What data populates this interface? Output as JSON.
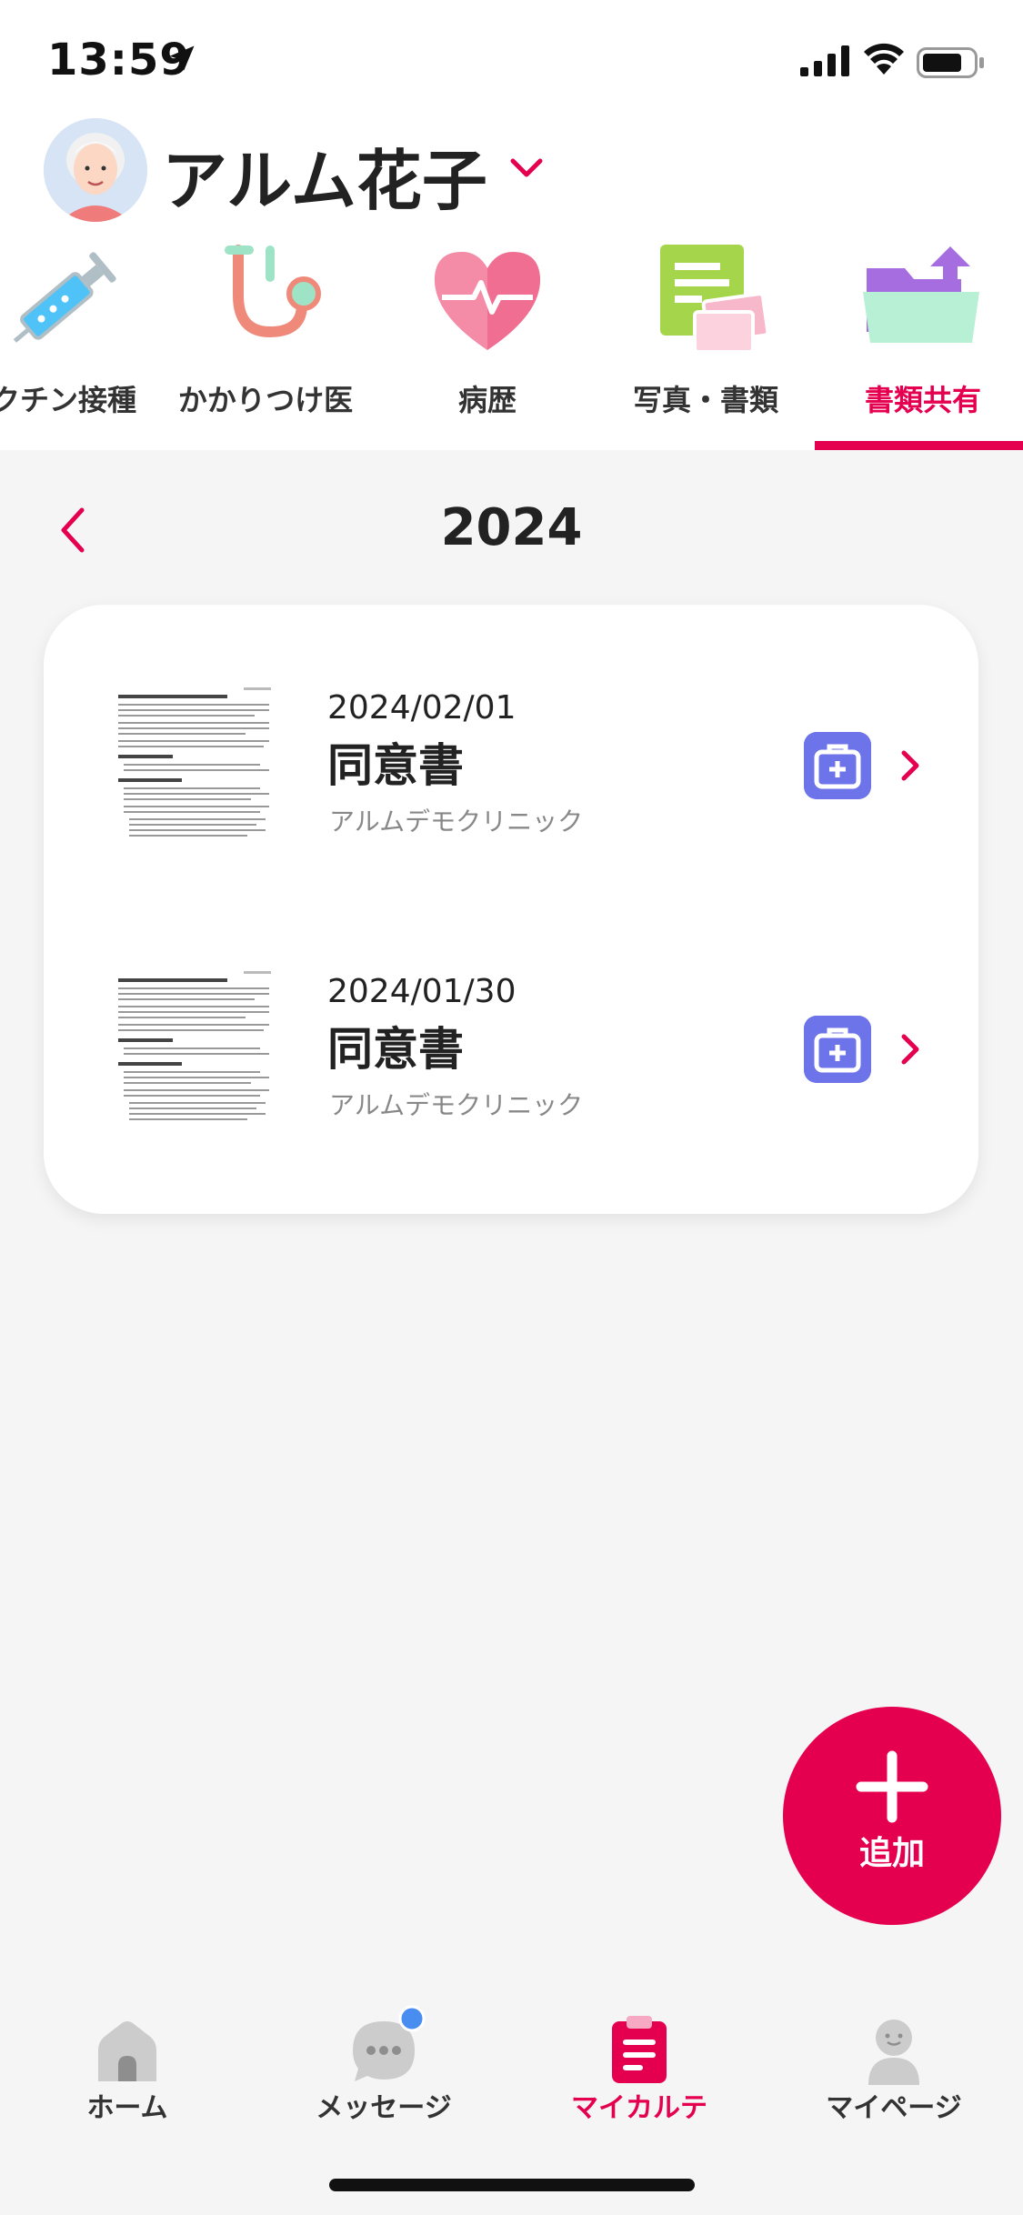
{
  "status_bar": {
    "time": "13:59"
  },
  "profile": {
    "name": "アルム花子"
  },
  "categories": [
    {
      "label": "クチン接種",
      "icon": "syringe-icon"
    },
    {
      "label": "かかりつけ医",
      "icon": "stethoscope-icon"
    },
    {
      "label": "病歴",
      "icon": "heart-pulse-icon"
    },
    {
      "label": "写真・書類",
      "icon": "photo-document-icon"
    },
    {
      "label": "書類共有",
      "icon": "folder-share-icon",
      "active": true
    }
  ],
  "year_nav": {
    "year": "2024"
  },
  "documents": [
    {
      "date": "2024/02/01",
      "title": "同意書",
      "clinic": "アルムデモクリニック"
    },
    {
      "date": "2024/01/30",
      "title": "同意書",
      "clinic": "アルムデモクリニック"
    }
  ],
  "fab": {
    "label": "追加"
  },
  "bottom_nav": [
    {
      "label": "ホーム",
      "icon": "home-icon"
    },
    {
      "label": "メッセージ",
      "icon": "message-icon",
      "has_badge": true
    },
    {
      "label": "マイカルテ",
      "icon": "medical-record-icon",
      "active": true
    },
    {
      "label": "マイページ",
      "icon": "person-icon"
    }
  ],
  "colors": {
    "accent": "#e5004f",
    "clinic_badge": "#6d73e8",
    "notification_dot": "#4a8df0"
  }
}
